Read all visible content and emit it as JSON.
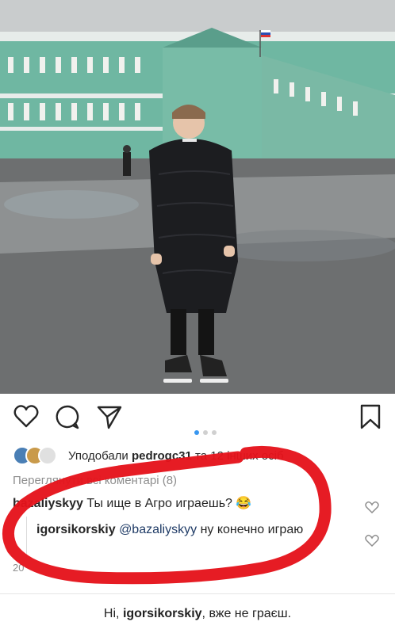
{
  "photo": {
    "alt": ""
  },
  "colors": {
    "accent": "#3897f0",
    "text": "#262626",
    "muted": "#8e8e8e",
    "mention": "#1f3b66",
    "markup": "#e5131b"
  },
  "actions": [
    {
      "icon": "heart-icon"
    },
    {
      "icon": "comment-icon"
    },
    {
      "icon": "share-icon"
    },
    {
      "icon": "bookmark-icon"
    }
  ],
  "carousel": {
    "count": 3,
    "active": 0
  },
  "likes": {
    "prefix": "Уподобали",
    "user": "pedrogc31",
    "suffix": "та 12 інших осіб"
  },
  "view_all": "Переглянути всі коментарі (8)",
  "comment": {
    "user": "bazaliyskyy",
    "text": "Ты ище в Агро играешь? 😂"
  },
  "reply": {
    "user": "igorsikorskiy",
    "mention": "@bazaliyskyy",
    "text": "ну конечно играю"
  },
  "date": "20",
  "caption": {
    "prefix": "Ні,",
    "user": "igorsikorskiy",
    "suffix": ", вже не граєш."
  }
}
